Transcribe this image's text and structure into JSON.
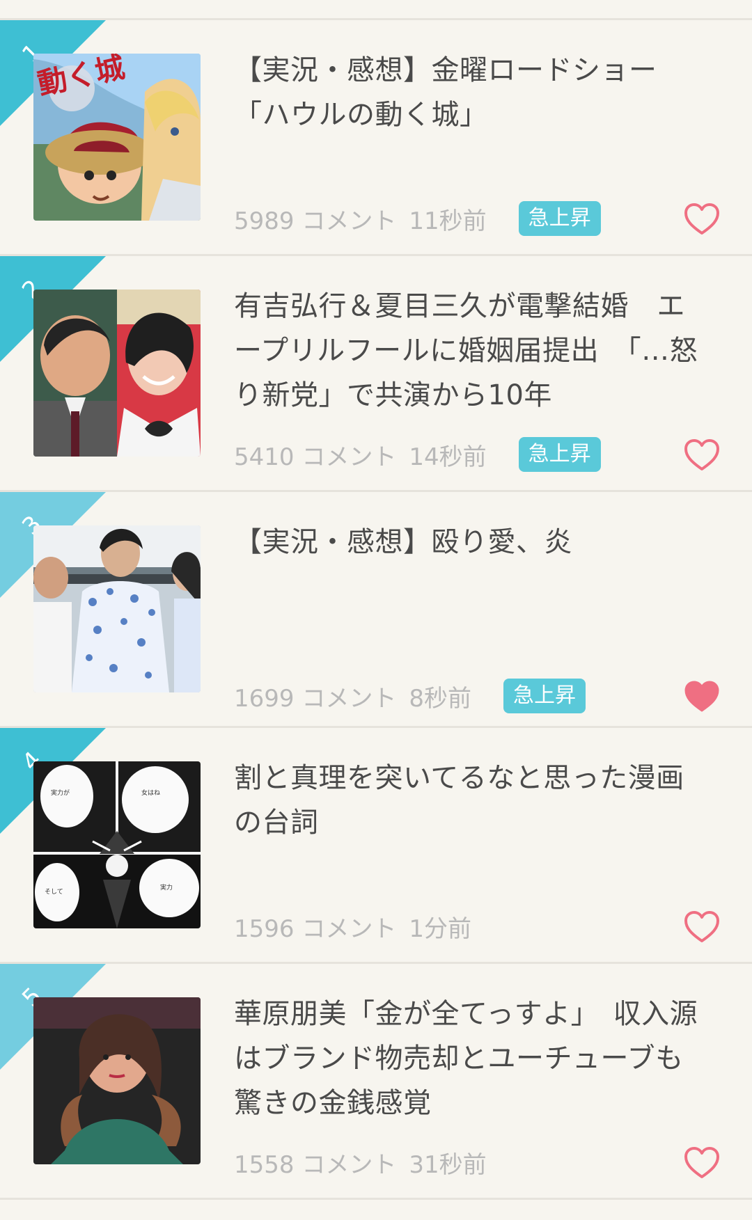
{
  "feed": {
    "rows": [
      {
        "rank": "1",
        "title": "【実況・感想】金曜ロードショー「ハウルの動く城」",
        "comments": "5989 コメント",
        "time": "11秒前",
        "badge": "急上昇",
        "liked": false
      },
      {
        "rank": "2",
        "title": "有吉弘行＆夏目三久が電撃結婚　エープリルフールに婚姻届提出　「…怒り新党」で共演から10年",
        "comments": "5410 コメント",
        "time": "14秒前",
        "badge": "急上昇",
        "liked": false
      },
      {
        "rank": "3",
        "title": "【実況・感想】殴り愛、炎",
        "comments": "1699 コメント",
        "time": "8秒前",
        "badge": "急上昇",
        "liked": true
      },
      {
        "rank": "4",
        "title": "割と真理を突いてるなと思った漫画の台詞",
        "comments": "1596 コメント",
        "time": "1分前",
        "badge": "",
        "liked": false
      },
      {
        "rank": "5",
        "title": "華原朋美「金が全てっすよ」　収入源はブランド物売却とユーチューブも驚きの金銭感覚",
        "comments": "1558 コメント",
        "time": "31秒前",
        "badge": "",
        "liked": false
      }
    ]
  },
  "colors": {
    "background": "#f7f5ef",
    "divider": "#e6e3dc",
    "rank_ribbon_dark": "#3ebfd3",
    "rank_ribbon_light": "#74cde0",
    "badge": "#5ac9d9",
    "heart": "#ef6f82",
    "title_text": "#4a4a4a",
    "meta_text": "#b8b8b8"
  },
  "icons": {
    "heart_outline": "heart-outline-icon",
    "heart_filled": "heart-filled-icon"
  }
}
